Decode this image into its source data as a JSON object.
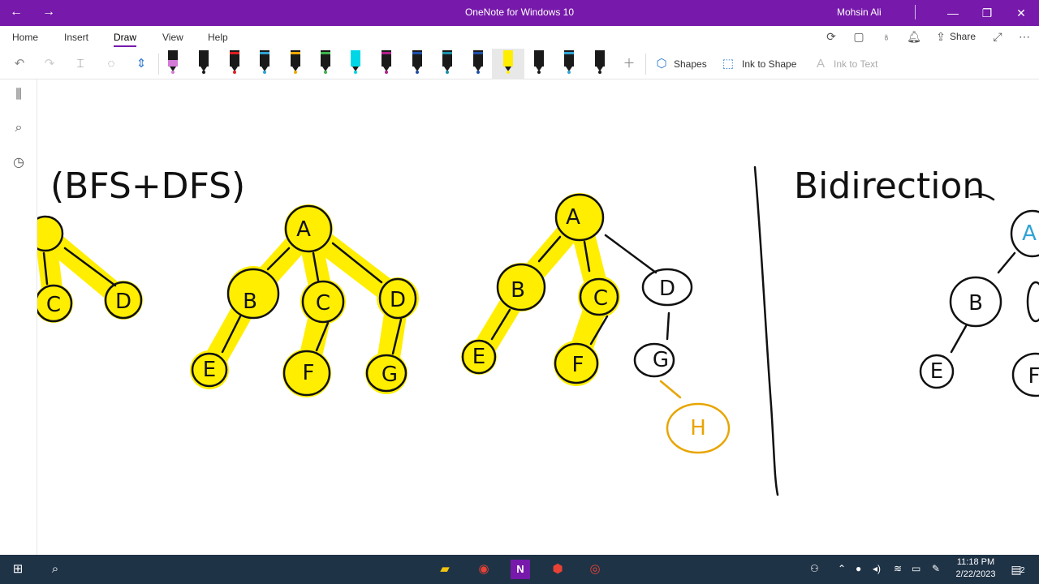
{
  "window": {
    "title": "OneNote for Windows 10",
    "user": "Mohsin Ali",
    "back_icon": "back-arrow-icon",
    "forward_icon": "forward-arrow-icon"
  },
  "menu": {
    "tabs": [
      {
        "label": "Home"
      },
      {
        "label": "Insert"
      },
      {
        "label": "Draw",
        "active": true
      },
      {
        "label": "View"
      },
      {
        "label": "Help"
      }
    ],
    "share_label": "Share"
  },
  "toolbar": {
    "shapes_label": "Shapes",
    "ink_to_shape_label": "Ink to Shape",
    "ink_to_text_label": "Ink to Text",
    "pens": [
      {
        "color": "#d27ad6",
        "type": "marker"
      },
      {
        "color": "#1a1a1a",
        "type": "pen"
      },
      {
        "color": "#e02020",
        "type": "pen"
      },
      {
        "color": "#2fa3d6",
        "type": "pen"
      },
      {
        "color": "#f0a800",
        "type": "pen"
      },
      {
        "color": "#3cb44b",
        "type": "pen"
      },
      {
        "color": "#00d7e6",
        "type": "highlighter"
      },
      {
        "color": "#b0208c",
        "type": "pen"
      },
      {
        "color": "#1f4fa8",
        "type": "pen"
      },
      {
        "color": "#1a8fa8",
        "type": "pen"
      },
      {
        "color": "#1f4fa8",
        "type": "pen"
      },
      {
        "color": "#ffee00",
        "type": "highlighter",
        "selected": true
      },
      {
        "color": "#1a1a1a",
        "type": "pen"
      },
      {
        "color": "#2fa3d6",
        "type": "pen"
      },
      {
        "color": "#1a1a1a",
        "type": "pen"
      }
    ]
  },
  "canvas": {
    "heading_left": "(BFS+DFS)",
    "heading_right": "Bidirection",
    "highlight_color": "#ffee00",
    "accent_node_color": "#e8a500",
    "tree1": {
      "nodes": [
        "A",
        "B",
        "C",
        "D",
        "E",
        "F",
        "G"
      ]
    },
    "tree2": {
      "nodes": [
        "A",
        "B",
        "C",
        "D",
        "E",
        "F",
        "G",
        "H"
      ]
    },
    "tree3": {
      "nodes": [
        "A",
        "B",
        "E",
        "F"
      ]
    },
    "tree0_partial": {
      "nodes": [
        "C",
        "D"
      ]
    }
  },
  "taskbar": {
    "time": "11:18 PM",
    "date": "2/22/2023",
    "notification_count": "2"
  }
}
